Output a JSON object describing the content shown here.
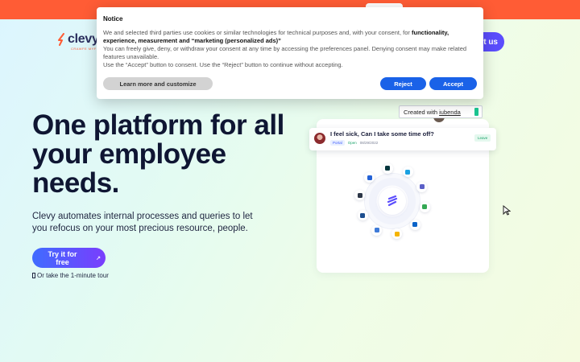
{
  "header": {
    "logo_text": "clevy",
    "logo_subtext": "CRAWFE MYFEA",
    "cta_label": "t us"
  },
  "hero": {
    "title": "One platform for all your employee needs.",
    "subtitle": "Clevy automates internal processes and queries to let you refocus on your most precious resource, people.",
    "primary_button": "Try it for free",
    "primary_button_icon": "↗",
    "tour_link": "Or take the 1-minute tour"
  },
  "illustration": {
    "message": {
      "text": "I feel sick, Can I take some time off?",
      "tag_portal": "Portal",
      "tag_status": "Open",
      "date": "08/29/2022",
      "badge": "Leave"
    },
    "integrations": [
      {
        "name": "salesforce-icon",
        "color": "#1ba1e2"
      },
      {
        "name": "teams-icon",
        "color": "#5b5fc7"
      },
      {
        "name": "google-drive-icon",
        "color": "#34a853"
      },
      {
        "name": "outlook-icon",
        "color": "#0a64c9"
      },
      {
        "name": "google-sheets-icon",
        "color": "#f5b400"
      },
      {
        "name": "mail-icon",
        "color": "#3f7bd8"
      },
      {
        "name": "workday-icon",
        "color": "#1d4e8f"
      },
      {
        "name": "notion-icon",
        "color": "#2d3748"
      },
      {
        "name": "jira-icon",
        "color": "#2462d6"
      },
      {
        "name": "zendesk-icon",
        "color": "#03363d"
      }
    ]
  },
  "iubenda_badge": {
    "prefix": "Created with",
    "link": "iubenda"
  },
  "cookie_notice": {
    "title": "Notice",
    "line1_a": "We and selected third parties use cookies or similar technologies for technical purposes and, with your consent, for ",
    "line1_b": "functionality, experience, measurement and “marketing (personalized ads)”",
    "line2": "You can freely give, deny, or withdraw your consent at any time by accessing the preferences panel. Denying consent may make related features unavailable.",
    "line3": "Use the “Accept” button to consent. Use the “Reject” button to continue without accepting.",
    "learn_more_label": "Learn more and customize",
    "reject_label": "Reject",
    "accept_label": "Accept"
  },
  "colors": {
    "topbar": "#ff5c35",
    "brand_purple": "#5b4dfd",
    "consent_blue": "#1a62e8",
    "heading": "#0f1633"
  }
}
